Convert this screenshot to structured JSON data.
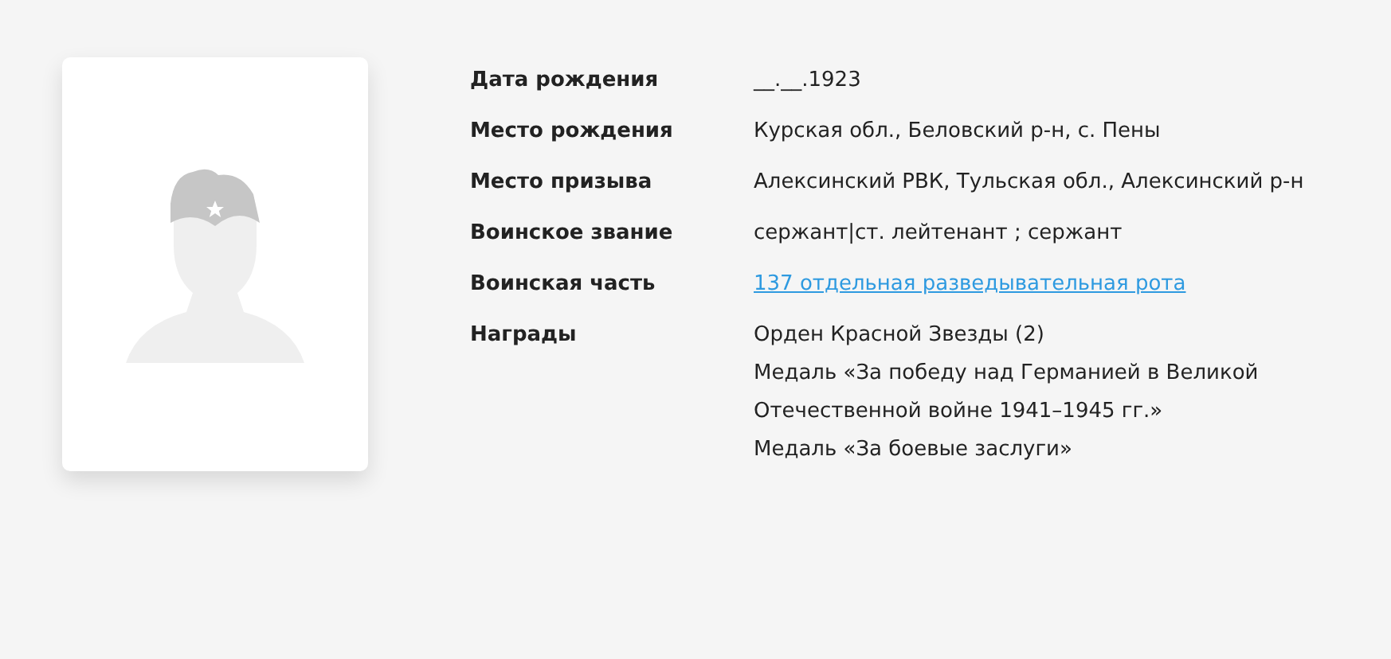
{
  "fields": [
    {
      "label": "Дата рождения",
      "kind": "text",
      "value": "__.__.1923"
    },
    {
      "label": "Место рождения",
      "kind": "text",
      "value": "Курская обл., Беловский р-н, с. Пены"
    },
    {
      "label": "Место призыва",
      "kind": "text",
      "value": "Алексинский РВК, Тульская обл., Алексинский р-н"
    },
    {
      "label": "Воинское звание",
      "kind": "text",
      "value": "сержант|ст. лейтенант ; сержант"
    },
    {
      "label": "Воинская часть",
      "kind": "link",
      "value": "137 отдельная разведывательная рота"
    },
    {
      "label": "Награды",
      "kind": "list",
      "items": [
        "Орден Красной Звезды (2)",
        "Медаль «За победу над Германией в Великой Отечественной войне 1941–1945 гг.»",
        "Медаль «За боевые заслуги»"
      ]
    }
  ]
}
